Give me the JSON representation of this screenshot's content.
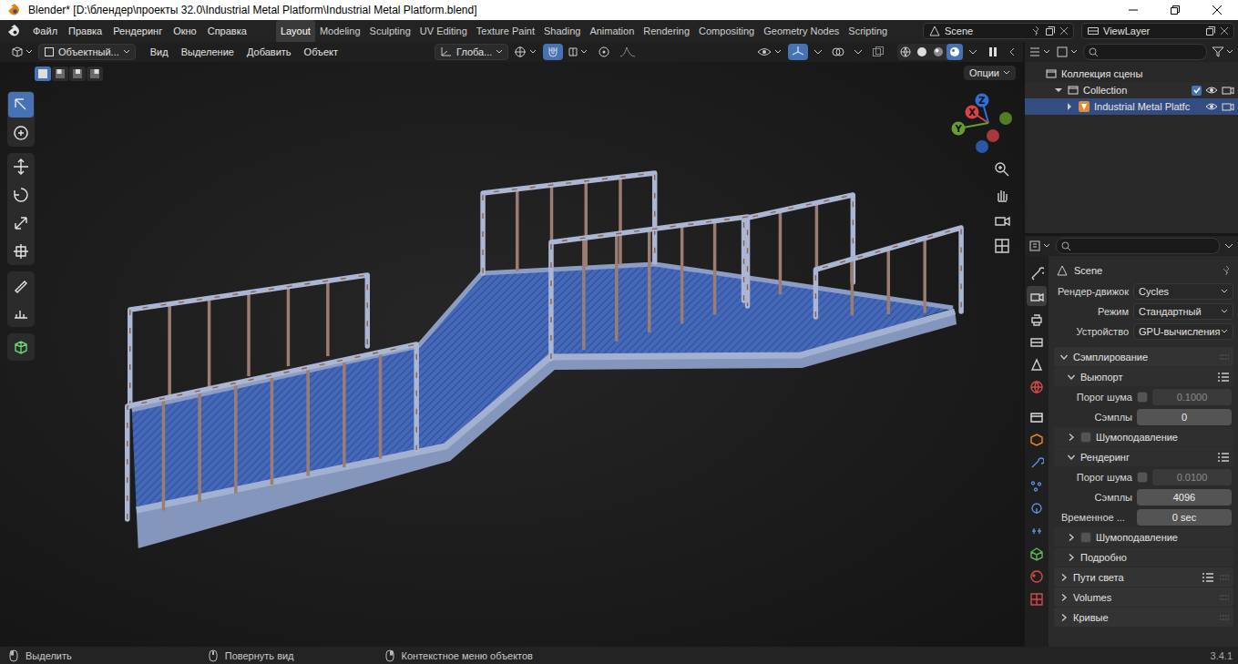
{
  "window": {
    "title": "Blender* [D:\\блендер\\проекты 32.0\\Industrial Metal Platform\\Industrial Metal Platform.blend]"
  },
  "menu": [
    "Файл",
    "Правка",
    "Рендеринг",
    "Окно",
    "Справка"
  ],
  "workspaces": [
    {
      "label": "Layout",
      "selected": true
    },
    {
      "label": "Modeling",
      "selected": false
    },
    {
      "label": "Sculpting",
      "selected": false
    },
    {
      "label": "UV Editing",
      "selected": false
    },
    {
      "label": "Texture Paint",
      "selected": false
    },
    {
      "label": "Shading",
      "selected": false
    },
    {
      "label": "Animation",
      "selected": false
    },
    {
      "label": "Rendering",
      "selected": false
    },
    {
      "label": "Compositing",
      "selected": false
    },
    {
      "label": "Geometry Nodes",
      "selected": false
    },
    {
      "label": "Scripting",
      "selected": false
    }
  ],
  "scene": "Scene",
  "view_layer": "ViewLayer",
  "viewport": {
    "mode": "Объектный...",
    "menu": [
      "Вид",
      "Выделение",
      "Добавить",
      "Объект"
    ],
    "orientation": "Глоба...",
    "options": "Опции",
    "select_modes": [
      {
        "selected": true
      },
      {
        "selected": false
      },
      {
        "selected": false
      },
      {
        "selected": false
      }
    ],
    "snap": {
      "on": true
    },
    "proportional": {
      "on": false
    },
    "gizmos": {
      "on": true
    },
    "overlays": {
      "on": false
    },
    "xray": {
      "on": false
    },
    "shading": [
      {
        "selected": false
      },
      {
        "selected": false
      },
      {
        "selected": false
      },
      {
        "selected": true
      }
    ],
    "tools": [
      {
        "selected": true
      },
      {
        "selected": false
      },
      {
        "selected": false
      },
      {
        "selected": false
      },
      {
        "selected": false
      },
      {
        "selected": false
      },
      {
        "selected": false
      },
      {
        "selected": false
      },
      {
        "selected": false
      }
    ],
    "gizmo": [
      {
        "label": "Z",
        "color": "#2f6fd6"
      },
      {
        "label": "X",
        "color": "#d8434b"
      },
      {
        "label": "Y",
        "color": "#66a02c"
      }
    ]
  },
  "outliner": {
    "root": "Коллекция сцены",
    "items": [
      {
        "label": "Collection",
        "expanded": true,
        "selected": false,
        "checked": true,
        "depth": 1
      },
      {
        "label": "Industrial Metal Platfc",
        "expanded": false,
        "selected": true,
        "checked": false,
        "depth": 2
      }
    ]
  },
  "properties": {
    "title": "Scene",
    "tabs": [
      {
        "selected": false,
        "color": "#d0d0d0"
      },
      {
        "selected": true,
        "color": "#d0d0d0"
      },
      {
        "selected": false,
        "color": "#d0d0d0"
      },
      {
        "selected": false,
        "color": "#d0d0d0"
      },
      {
        "selected": false,
        "color": "#d0d0d0"
      },
      {
        "selected": false,
        "color": "#d24a4a"
      },
      {
        "selected": false,
        "color": "#e0e0e0"
      },
      {
        "selected": false,
        "color": "#e88a2e"
      },
      {
        "selected": false,
        "color": "#5b8fd6"
      },
      {
        "selected": false,
        "color": "#5b8fd6"
      },
      {
        "selected": false,
        "color": "#5b8fd6"
      },
      {
        "selected": false,
        "color": "#5b8fd6"
      },
      {
        "selected": false,
        "color": "#5fb35a"
      },
      {
        "selected": false,
        "color": "#d24a4a"
      },
      {
        "selected": false,
        "color": "#d24a4a"
      }
    ],
    "fields": [
      {
        "label": "Рендер-движок",
        "value": "Cycles"
      },
      {
        "label": "Режим",
        "value": "Стандартный"
      },
      {
        "label": "Устройство",
        "value": "GPU-вычисления"
      }
    ],
    "rows": [
      {
        "kind": "panel",
        "label": "Сэмплирование",
        "expanded": true,
        "presets": false
      },
      {
        "kind": "subpanel",
        "label": "Выюпорт",
        "expanded": true,
        "presets": true
      },
      {
        "kind": "toggle-number",
        "label": "Порог шума",
        "checked": false,
        "value": "0.1000",
        "disabled": true
      },
      {
        "kind": "number",
        "label": "Сэмплы",
        "value": "0"
      },
      {
        "kind": "check-subpanel",
        "label": "Шумоподавление",
        "expanded": false,
        "checked": false
      },
      {
        "kind": "subpanel",
        "label": "Рендеринг",
        "expanded": true,
        "presets": true
      },
      {
        "kind": "toggle-number",
        "label": "Порог шума",
        "checked": false,
        "value": "0.0100",
        "disabled": true
      },
      {
        "kind": "number",
        "label": "Сэмплы",
        "value": "4096"
      },
      {
        "kind": "number",
        "label": "Временное ...",
        "value": "0 sec"
      },
      {
        "kind": "check-subpanel",
        "label": "Шумоподавление",
        "expanded": false,
        "checked": false
      },
      {
        "kind": "subpanel",
        "label": "Подробно",
        "expanded": false,
        "presets": false
      },
      {
        "kind": "panel",
        "label": "Пути света",
        "expanded": false,
        "presets": true
      },
      {
        "kind": "panel",
        "label": "Volumes",
        "expanded": false,
        "presets": false
      },
      {
        "kind": "panel",
        "label": "Кривые",
        "expanded": false,
        "presets": false
      }
    ]
  },
  "status_bar": {
    "items": [
      "Выделить",
      "Повернуть вид",
      "Контекстное меню объектов"
    ],
    "version": "3.4.1"
  }
}
